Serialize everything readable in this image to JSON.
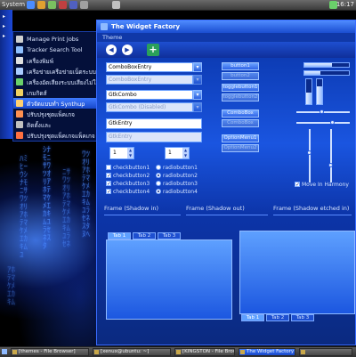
{
  "top_panel": {
    "system_label": "System",
    "clock": "16:17"
  },
  "system_menu": {
    "items": [
      {
        "label": "Manage Print Jobs",
        "icon": "printer-icon",
        "color": "#d0d0d0"
      },
      {
        "label": "Tracker Search Tool",
        "icon": "search-icon",
        "color": "#8fc0ff"
      },
      {
        "label": "เครื่องพิมพ์",
        "icon": "printer-icon",
        "color": "#e0e0e0"
      },
      {
        "label": "เครือข่ายเครือข่ายเน็ตระบบบ",
        "icon": "network-icon",
        "color": "#aaccff"
      },
      {
        "label": "เครื่องอัดเสียงระบบเสียงไม่ใช้ยังจังจ",
        "icon": "sound-icon",
        "color": "#6ad06a"
      },
      {
        "label": "เกมกิดส์",
        "icon": "games-icon",
        "color": "#f0d060"
      },
      {
        "label": "ตัวจัดแบบทำ Synthup",
        "icon": "sync-icon",
        "color": "#ffd070",
        "highlighted": true
      },
      {
        "label": "ปรับปรุงชุดแพ็คเกจ",
        "icon": "package-icon",
        "color": "#ff9050"
      },
      {
        "label": "ติดตั้งและ",
        "icon": "install-icon",
        "color": "#c0c0c0"
      },
      {
        "label": "ปรับปรุงชุดแพ็คเกจแพ็คเกจ",
        "icon": "update-icon",
        "color": "#ff7040"
      }
    ]
  },
  "window": {
    "title": "The Widget Factory",
    "menu": "Theme",
    "toolbar": {
      "back": "◀",
      "forward": "▶",
      "add": "+"
    },
    "entries": {
      "combo_entry": "ComboBoxEntry",
      "combo_entry_dis": "ComboBoxEntry",
      "gtk_combo": "GtkCombo",
      "gtk_combo_dis": "GtkCombo (Disabled)",
      "gtk_entry": "GtkEntry",
      "gtk_entry_dis": "GtkEntry"
    },
    "spin1": "1",
    "spin2": "1",
    "checks": [
      {
        "label": "checkbutton1",
        "checked": false
      },
      {
        "label": "checkbutton2",
        "checked": true
      },
      {
        "label": "checkbutton3",
        "checked": true
      },
      {
        "label": "checkbutton4",
        "checked": true
      }
    ],
    "radios": [
      {
        "label": "radiobutton1",
        "on": false
      },
      {
        "label": "radiobutton2",
        "on": true
      },
      {
        "label": "radiobutton3",
        "on": false
      },
      {
        "label": "radiobutton4",
        "on": true
      }
    ],
    "buttons": {
      "button1": "button1",
      "button2": "button2",
      "toggle1": "togglebutton1",
      "toggle2": "togglebutton2",
      "combo1": "ComboBox",
      "combo2": "ComboBox",
      "option1": "OptionMenu1",
      "option2": "OptionMenu2"
    },
    "progress": {
      "h1": 0.62,
      "h2": 0.35,
      "v1": 0.45,
      "v2": 0.7
    },
    "move_in_harmony": "Move In Harmony",
    "frames": [
      "Frame (Shadow in)",
      "Frame (Shadow out)",
      "Frame (Shadow etched in)"
    ],
    "tabs_top": [
      "Tab 1",
      "Tab 2",
      "Tab 3"
    ],
    "tabs_bottom": [
      "Tab 1",
      "Tab 2",
      "Tab 3"
    ]
  },
  "taskbar": [
    {
      "label": "[themes - File Browser]"
    },
    {
      "label": "[xenux@ubuntu: ~]"
    },
    {
      "label": "[KINGSTON - File Browser]"
    },
    {
      "label": "The Widget Factory",
      "active": true
    },
    {
      "label": ""
    }
  ]
}
